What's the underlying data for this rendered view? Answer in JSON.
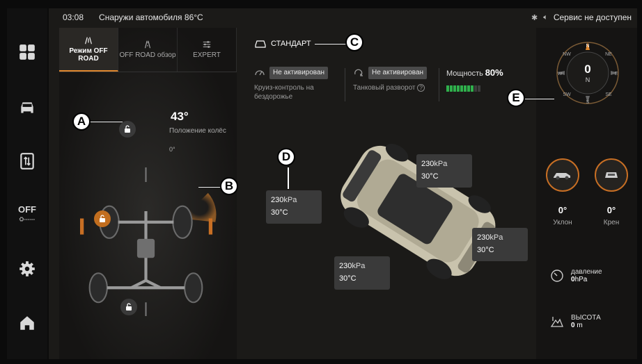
{
  "status_bar": {
    "time": "03:08",
    "outside_temp": "Снаружи автомобиля 86°C",
    "service": "Сервис не доступен"
  },
  "sidebar": {
    "items": [
      {
        "name": "apps-icon"
      },
      {
        "name": "car-icon"
      },
      {
        "name": "screen-icon"
      },
      {
        "label": "OFF",
        "name": "offroad-toggle"
      },
      {
        "name": "settings-icon"
      },
      {
        "name": "home-icon"
      }
    ]
  },
  "tabs": [
    {
      "label": "Режим OFF ROAD",
      "icon": "offroad-mode-icon",
      "active": true
    },
    {
      "label": "OFF ROAD обзор",
      "icon": "road-view-icon",
      "active": false
    },
    {
      "label": "EXPERT",
      "icon": "sliders-icon",
      "active": false
    }
  ],
  "wheels": {
    "angle": "43°",
    "angle_label": "Положение колёс",
    "zero": "0°"
  },
  "callouts": [
    "A",
    "B",
    "C",
    "D",
    "E"
  ],
  "mode": {
    "label": "СТАНДАРТ"
  },
  "cruise": {
    "status": "Не активирован",
    "label": "Круиз-контроль на бездорожье"
  },
  "tank_turn": {
    "status": "Не активирован",
    "label": "Танковый разворот"
  },
  "power": {
    "label": "Мощность",
    "value": "80%",
    "level": 0.8,
    "color": "#2fb04c"
  },
  "tires": [
    {
      "pressure": "230",
      "unit": "kPa",
      "temp": "30°C"
    },
    {
      "pressure": "230",
      "unit": "kPa",
      "temp": "30°C"
    },
    {
      "pressure": "230",
      "unit": "kPa",
      "temp": "30°C"
    },
    {
      "pressure": "230",
      "unit": "kPa",
      "temp": "30°C"
    }
  ],
  "compass": {
    "value": "0",
    "direction": "N",
    "labels": [
      "N",
      "NE",
      "E",
      "SE",
      "S",
      "SW",
      "W",
      "NW"
    ]
  },
  "slope": {
    "value": "0°",
    "label": "Уклон"
  },
  "roll": {
    "value": "0°",
    "label": "Крен"
  },
  "pressure": {
    "label": "давление",
    "value": "0",
    "unit": "hPa"
  },
  "altitude": {
    "label": "ВЫСОТА",
    "value": "0",
    "unit": "m"
  },
  "accent_color": "#e0872e"
}
